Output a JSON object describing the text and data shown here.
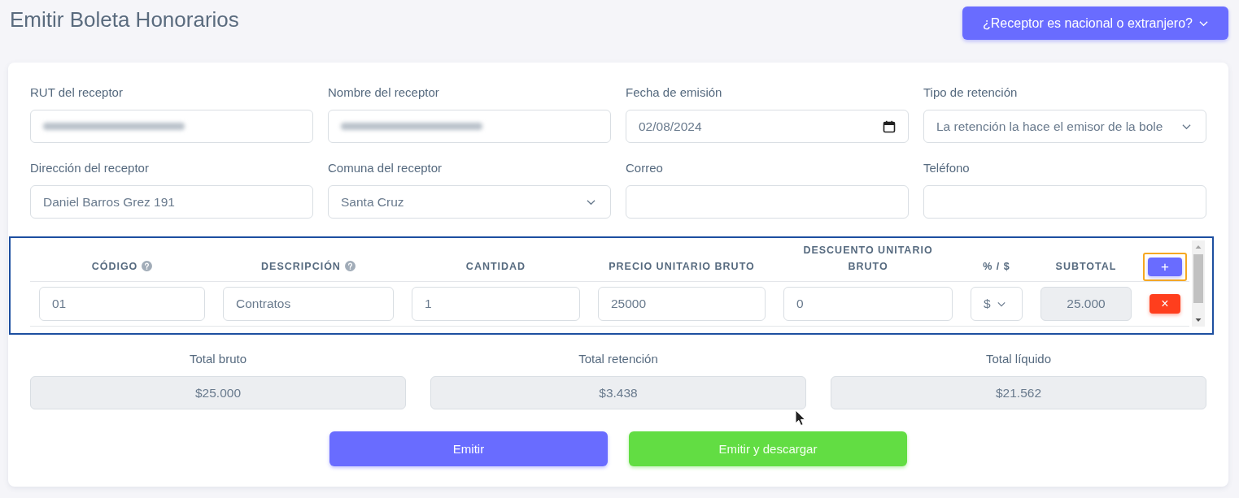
{
  "page_title": "Emitir Boleta Honorarios",
  "receptor_type_menu": {
    "label": "¿Receptor es nacional o extranjero?"
  },
  "receptor_fields": [
    {
      "label": "RUT del receptor",
      "kind": "text",
      "redacted": true
    },
    {
      "label": "Nombre del receptor",
      "kind": "text",
      "redacted": true
    },
    {
      "label": "Fecha de emisión",
      "kind": "date",
      "redacted": false,
      "value": "02/08/2024"
    },
    {
      "label": "Tipo de retención",
      "kind": "select",
      "redacted": false,
      "value": "La retención la hace el emisor de la bole"
    },
    {
      "label": "Dirección del receptor",
      "kind": "text",
      "redacted": false,
      "value": "Daniel Barros Grez 191"
    },
    {
      "label": "Comuna del receptor",
      "kind": "select",
      "redacted": false,
      "value": "Santa Cruz"
    },
    {
      "label": "Correo",
      "kind": "text",
      "redacted": false
    },
    {
      "label": "Teléfono",
      "kind": "text",
      "redacted": false
    }
  ],
  "items_table": {
    "columns": [
      {
        "label": "CÓDIGO",
        "help": true
      },
      {
        "label": "DESCRIPCIÓN",
        "help": true
      },
      {
        "label": "CANTIDAD",
        "help": false
      },
      {
        "label": "PRECIO UNITARIO BRUTO",
        "help": false
      },
      {
        "label": "DESCUENTO UNITARIO BRUTO",
        "help": false
      },
      {
        "label": "% / $",
        "help": false
      },
      {
        "label": "SUBTOTAL",
        "help": false
      }
    ],
    "add_button": {
      "label": "+",
      "focused": true
    },
    "rows": [
      {
        "cells": [
          {
            "kind": "input",
            "value": "01"
          },
          {
            "kind": "input",
            "value": "Contratos"
          },
          {
            "kind": "input",
            "value": "1"
          },
          {
            "kind": "input",
            "value": "25000"
          },
          {
            "kind": "input",
            "value": "0"
          },
          {
            "kind": "select",
            "value": "$"
          },
          {
            "kind": "readonly",
            "value": "25.000"
          }
        ],
        "delete_button": {
          "label": "×"
        }
      }
    ]
  },
  "totals": [
    {
      "label": "Total bruto",
      "value": "$25.000"
    },
    {
      "label": "Total retención",
      "value": "$3.438"
    },
    {
      "label": "Total líquido",
      "value": "$21.562"
    }
  ],
  "actions": [
    {
      "label": "Emitir",
      "kind": "primary"
    },
    {
      "label": "Emitir y descargar",
      "kind": "success"
    }
  ]
}
